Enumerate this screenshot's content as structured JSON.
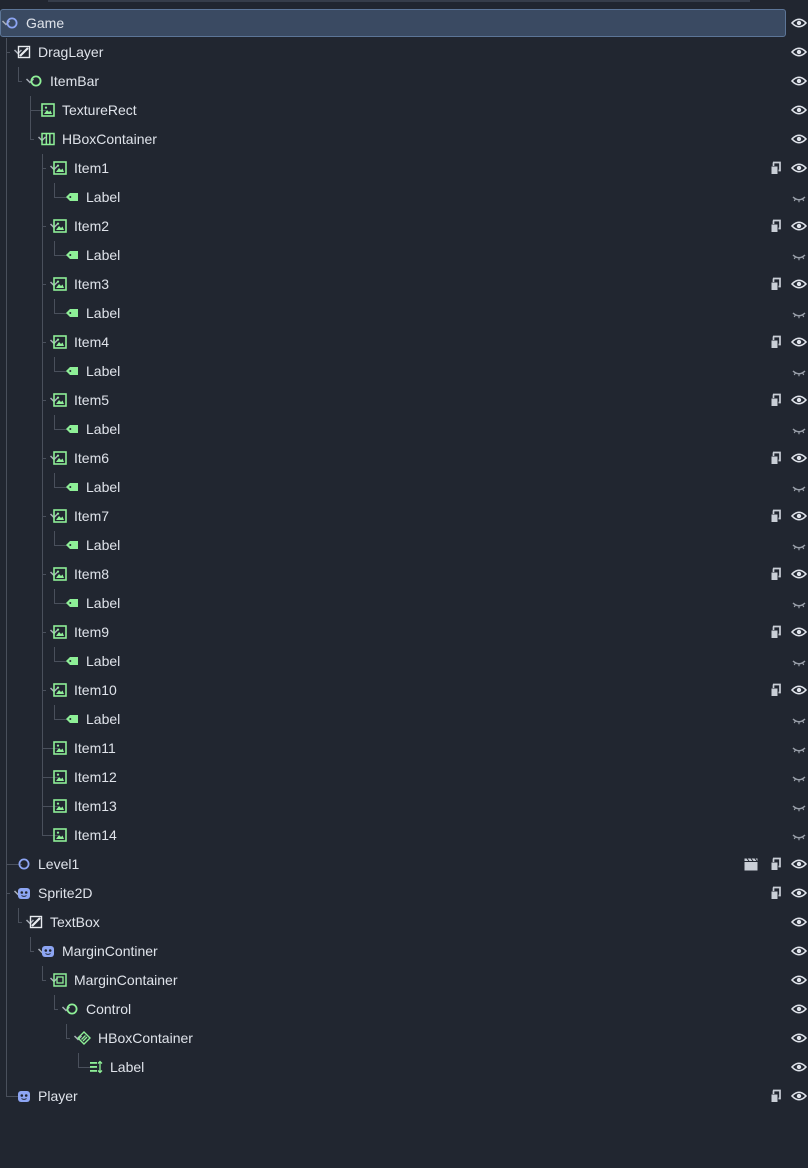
{
  "scene_tree": {
    "nodes": [
      {
        "label": "Game",
        "icon": "node-circle-icon",
        "selected": true,
        "visibility": "eye-icon"
      },
      {
        "label": "DragLayer",
        "icon": "canvas-layer-icon",
        "visibility": "eye-icon"
      },
      {
        "label": "ItemBar",
        "icon": "control-circle-icon",
        "visibility": "eye-icon"
      },
      {
        "label": "TextureRect",
        "icon": "texture-rect-icon",
        "visibility": "eye-icon"
      },
      {
        "label": "HBoxContainer",
        "icon": "hbox-container-icon",
        "visibility": "eye-icon"
      },
      {
        "label": "Item1",
        "icon": "texture-rect-icon",
        "script": true,
        "visibility": "eye-icon"
      },
      {
        "label": "Label",
        "icon": "label-icon",
        "visibility": "eye-closed-icon"
      },
      {
        "label": "Item2",
        "icon": "texture-rect-icon",
        "script": true,
        "visibility": "eye-icon"
      },
      {
        "label": "Label",
        "icon": "label-icon",
        "visibility": "eye-closed-icon"
      },
      {
        "label": "Item3",
        "icon": "texture-rect-icon",
        "script": true,
        "visibility": "eye-icon"
      },
      {
        "label": "Label",
        "icon": "label-icon",
        "visibility": "eye-closed-icon"
      },
      {
        "label": "Item4",
        "icon": "texture-rect-icon",
        "script": true,
        "visibility": "eye-icon"
      },
      {
        "label": "Label",
        "icon": "label-icon",
        "visibility": "eye-closed-icon"
      },
      {
        "label": "Item5",
        "icon": "texture-rect-icon",
        "script": true,
        "visibility": "eye-icon"
      },
      {
        "label": "Label",
        "icon": "label-icon",
        "visibility": "eye-closed-icon"
      },
      {
        "label": "Item6",
        "icon": "texture-rect-icon",
        "script": true,
        "visibility": "eye-icon"
      },
      {
        "label": "Label",
        "icon": "label-icon",
        "visibility": "eye-closed-icon"
      },
      {
        "label": "Item7",
        "icon": "texture-rect-icon",
        "script": true,
        "visibility": "eye-icon"
      },
      {
        "label": "Label",
        "icon": "label-icon",
        "visibility": "eye-closed-icon"
      },
      {
        "label": "Item8",
        "icon": "texture-rect-icon",
        "script": true,
        "visibility": "eye-icon"
      },
      {
        "label": "Label",
        "icon": "label-icon",
        "visibility": "eye-closed-icon"
      },
      {
        "label": "Item9",
        "icon": "texture-rect-icon",
        "script": true,
        "visibility": "eye-icon"
      },
      {
        "label": "Label",
        "icon": "label-icon",
        "visibility": "eye-closed-icon"
      },
      {
        "label": "Item10",
        "icon": "texture-rect-icon",
        "script": true,
        "visibility": "eye-icon"
      },
      {
        "label": "Label",
        "icon": "label-icon",
        "visibility": "eye-closed-icon"
      },
      {
        "label": "Item11",
        "icon": "texture-rect-icon",
        "visibility": "eye-closed-icon"
      },
      {
        "label": "Item12",
        "icon": "texture-rect-icon",
        "visibility": "eye-closed-icon"
      },
      {
        "label": "Item13",
        "icon": "texture-rect-icon",
        "visibility": "eye-closed-icon"
      },
      {
        "label": "Item14",
        "icon": "texture-rect-icon",
        "visibility": "eye-closed-icon"
      },
      {
        "label": "Level1",
        "icon": "node-circle-icon",
        "scene": true,
        "script": true,
        "visibility": "eye-icon"
      },
      {
        "label": "Sprite2D",
        "icon": "sprite2d-icon",
        "script": true,
        "visibility": "eye-icon"
      },
      {
        "label": "TextBox",
        "icon": "canvas-layer-icon",
        "visibility": "eye-icon"
      },
      {
        "label": "MarginContiner",
        "icon": "sprite2d-icon",
        "visibility": "eye-icon"
      },
      {
        "label": "MarginContainer",
        "icon": "margin-container-icon",
        "visibility": "eye-icon"
      },
      {
        "label": "Control",
        "icon": "control-circle-icon",
        "visibility": "eye-icon"
      },
      {
        "label": "HBoxContainer",
        "icon": "flow-container-icon",
        "visibility": "eye-icon"
      },
      {
        "label": "Label",
        "icon": "rich-label-icon",
        "visibility": "eye-icon"
      },
      {
        "label": "Player",
        "icon": "sprite2d-icon",
        "script": true,
        "visibility": "eye-icon"
      }
    ]
  },
  "colors": {
    "background": "#212630",
    "selection": "#3a4a62",
    "node_blue": "#8da5f3",
    "control_green": "#8eef97",
    "text": "#dfe3ea",
    "muted_icon": "#c9ced6"
  }
}
